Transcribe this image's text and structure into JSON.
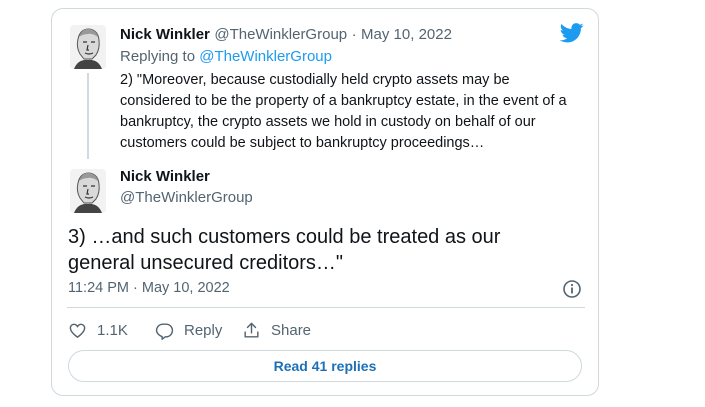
{
  "colors": {
    "accent": "#1d9bf0",
    "text": "#0f1419",
    "muted": "#536471",
    "border": "#cfd9de"
  },
  "parent_tweet": {
    "display_name": "Nick Winkler",
    "handle": "@TheWinklerGroup",
    "separator": "·",
    "date": "May 10, 2022",
    "replying_label": "Replying to",
    "replying_handle": "@TheWinklerGroup",
    "text": "2) \"Moreover, because custodially held crypto assets may be considered to be the property of a bankruptcy estate, in the event of a bankruptcy, the crypto assets we hold in custody on behalf of our customers could be subject to bankruptcy proceedings…"
  },
  "main_tweet": {
    "display_name": "Nick Winkler",
    "handle": "@TheWinklerGroup",
    "text": "3) …and such customers could be treated as our general unsecured creditors…\"",
    "timestamp": "11:24 PM · May 10, 2022"
  },
  "actions": {
    "like_count": "1.1K",
    "reply_label": "Reply",
    "share_label": "Share"
  },
  "read_replies_label": "Read 41 replies",
  "icons": [
    "twitter-bird-icon",
    "info-icon",
    "heart-icon",
    "reply-icon",
    "share-icon"
  ]
}
